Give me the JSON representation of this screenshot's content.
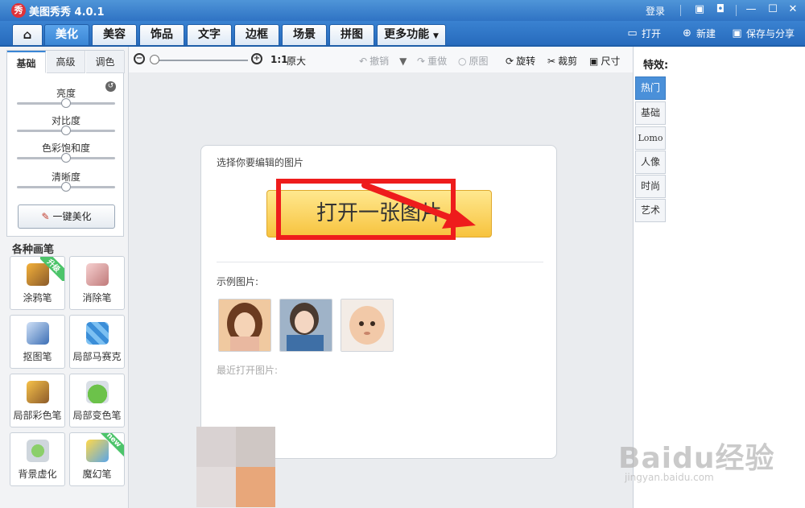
{
  "app": {
    "logo_char": "秀",
    "title": "美图秀秀 4.0.1",
    "login": "登录"
  },
  "tabs": [
    {
      "label": ""
    },
    {
      "label": "美化"
    },
    {
      "label": "美容"
    },
    {
      "label": "饰品"
    },
    {
      "label": "文字"
    },
    {
      "label": "边框"
    },
    {
      "label": "场景"
    },
    {
      "label": "拼图"
    },
    {
      "label": "更多功能"
    }
  ],
  "top_actions": {
    "open": "打开",
    "new": "新建",
    "save": "保存与分享"
  },
  "left": {
    "subtabs": [
      "基础",
      "高级",
      "调色"
    ],
    "sliders": [
      {
        "label": "亮度",
        "value": 0.5
      },
      {
        "label": "对比度",
        "value": 0.5
      },
      {
        "label": "色彩饱和度",
        "value": 0.5
      },
      {
        "label": "清晰度",
        "value": 0.5
      }
    ],
    "one_click": "一键美化",
    "brush_title": "各种画笔",
    "brushes": [
      {
        "label": "涂鸦笔",
        "badge": "升级"
      },
      {
        "label": "消除笔",
        "badge": ""
      },
      {
        "label": "抠图笔",
        "badge": ""
      },
      {
        "label": "局部马赛克",
        "badge": ""
      },
      {
        "label": "局部彩色笔",
        "badge": ""
      },
      {
        "label": "局部变色笔",
        "badge": ""
      },
      {
        "label": "背景虚化",
        "badge": ""
      },
      {
        "label": "魔幻笔",
        "badge": "new"
      }
    ]
  },
  "toolbar": {
    "ratio": "1:1",
    "original_size": "原大",
    "undo": "撤销",
    "redo": "重做",
    "original": "原图",
    "rotate": "旋转",
    "crop": "裁剪",
    "resize": "尺寸"
  },
  "main": {
    "choose_label": "选择你要编辑的图片",
    "open_button": "打开一张图片",
    "example_label": "示例图片:",
    "recent_label": "最近打开图片:"
  },
  "right": {
    "title": "特效:",
    "tabs": [
      "热门",
      "基础",
      "Lomo",
      "人像",
      "时尚",
      "艺术"
    ]
  },
  "watermark": {
    "main": "Baidu经验",
    "sub": "jingyan.baidu.com"
  },
  "colors": {
    "accent": "#3a86d5",
    "highlight": "#ee1c1c",
    "button": "#f7c33e"
  }
}
